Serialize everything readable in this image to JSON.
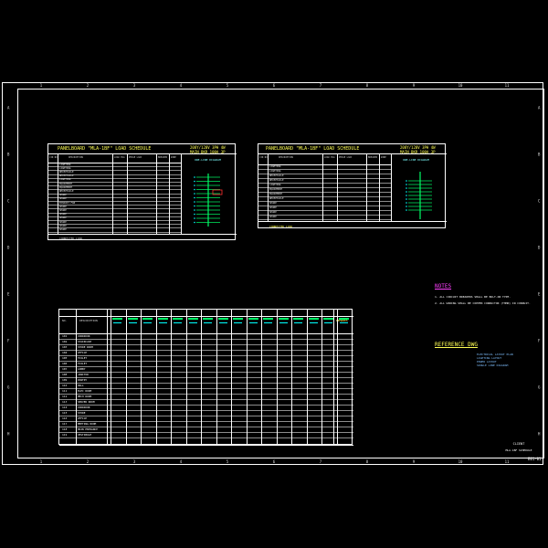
{
  "drawing": {
    "grid_columns": [
      "1",
      "2",
      "3",
      "4",
      "5",
      "6",
      "7",
      "8",
      "9",
      "10",
      "11"
    ],
    "grid_rows": [
      "A",
      "B",
      "C",
      "D",
      "E",
      "F",
      "G",
      "H"
    ]
  },
  "panel_schedule_left": {
    "title": "PANELBOARD \"MLA-1BF\" LOAD SCHEDULE",
    "subtitle_lines": [
      "208Y/120V 3PH 4W",
      "MAIN BKR 100A 3P"
    ],
    "diagram_label": "ONE-LINE DIAGRAM",
    "col_headers": [
      "CIR NO.",
      "DESCRIPTION",
      "LOAD KVA",
      "PHASE LOAD",
      "BREAKER",
      "WIRE"
    ],
    "rows": [
      "LIGHTING",
      "LIGHTING",
      "RECEPTACLE",
      "RECEPTACLE",
      "LIGHTING",
      "EQUIPMENT",
      "EQUIPMENT",
      "RECEPTACLE",
      "SPARE",
      "SPARE",
      "EXHAUST FAN",
      "SPARE",
      "SPARE",
      "SPARE",
      "SPARE",
      "SPARE",
      "SPARE",
      "SPARE"
    ],
    "footer": "CONNECTED LOAD"
  },
  "panel_schedule_right": {
    "title": "PANELBOARD \"MLA-1BF\" LOAD SCHEDULE",
    "subtitle_lines": [
      "208Y/120V 3PH 4W",
      "MAIN BKR 100A 3P"
    ],
    "diagram_label": "ONE-LINE DIAGRAM",
    "col_headers": [
      "CIR NO.",
      "DESCRIPTION",
      "LOAD KVA",
      "PHASE LOAD",
      "BREAKER",
      "WIRE"
    ],
    "rows": [
      "LIGHTING",
      "LIGHTING",
      "RECEPTACLE",
      "RECEPTACLE",
      "LIGHTING",
      "EQUIPMENT",
      "EQUIPMENT",
      "RECEPTACLE",
      "SPARE",
      "SPARE",
      "SPARE",
      "SPARE"
    ],
    "footer": "CONNECTED LOAD"
  },
  "room_schedule": {
    "header_first": "NO.",
    "header_second": "DESCRIPTION",
    "header_last": "REMARKS",
    "rows": [
      {
        "no": "101",
        "desc": "CORRIDOR"
      },
      {
        "no": "102",
        "desc": "STAIRCASE"
      },
      {
        "no": "103",
        "desc": "STORE ROOM"
      },
      {
        "no": "104",
        "desc": "OFFICE"
      },
      {
        "no": "105",
        "desc": "TOILET"
      },
      {
        "no": "106",
        "desc": "TOILET"
      },
      {
        "no": "107",
        "desc": "LOBBY"
      },
      {
        "no": "108",
        "desc": "JANITOR"
      },
      {
        "no": "109",
        "desc": "PANTRY"
      },
      {
        "no": "110",
        "desc": "HALL"
      },
      {
        "no": "111",
        "desc": "ELEC ROOM"
      },
      {
        "no": "112",
        "desc": "MECH ROOM"
      },
      {
        "no": "113",
        "desc": "SERVER ROOM"
      },
      {
        "no": "114",
        "desc": "CORRIDOR"
      },
      {
        "no": "115",
        "desc": "STORE"
      },
      {
        "no": "116",
        "desc": "OFFICE"
      },
      {
        "no": "117",
        "desc": "MEETING ROOM"
      },
      {
        "no": "118",
        "desc": "MAIN ENTRANCE"
      },
      {
        "no": "119",
        "desc": "VESTIBULE"
      }
    ]
  },
  "notes": {
    "title": "NOTES",
    "items": [
      "1. ALL CIRCUIT BREAKERS SHALL BE BOLT-ON TYPE.",
      "2. ALL WIRING SHALL BE COPPER CONDUCTOR (THHN) IN CONDUIT."
    ]
  },
  "reference": {
    "title": "REFERENCE DWG",
    "lines": [
      "ELECTRICAL LAYOUT PLAN",
      "LIGHTING LAYOUT",
      "POWER LAYOUT",
      "SINGLE LINE DIAGRAM"
    ]
  },
  "title_block": {
    "line1": "CLIENT",
    "line2": "MLA-1BF SCHEDULE",
    "sheet": "E01-01"
  },
  "colors": {
    "background": "#000000",
    "line": "#ffffff",
    "title": "#ffff55",
    "accent_cyan": "#00ffff",
    "accent_green": "#00ff66",
    "accent_magenta": "#ff40ff",
    "accent_red": "#ff3030"
  }
}
